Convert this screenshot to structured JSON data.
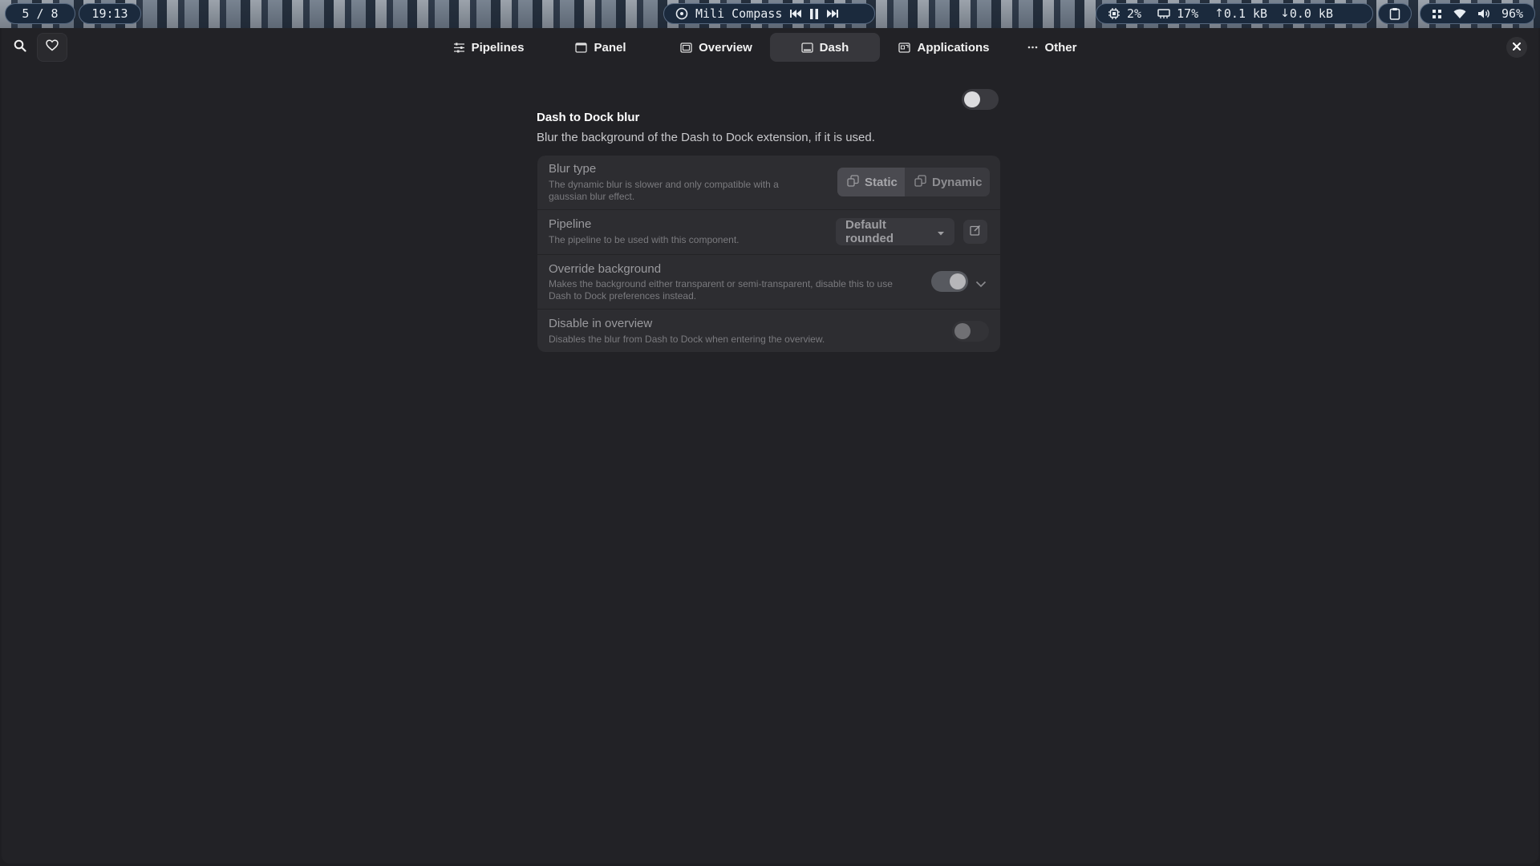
{
  "topbar": {
    "workspace": "5 / 8",
    "clock": "19:13",
    "media": {
      "title": "Mili Compass",
      "disc_icon": "disc-icon",
      "prev_icon": "previous-track-icon",
      "pause_icon": "pause-icon",
      "next_icon": "next-track-icon"
    },
    "stats": {
      "cpu": "2%",
      "memory": "17%",
      "upload": "0.1 kB",
      "download": "0.0 kB"
    },
    "clipboard_icon": "clipboard-icon",
    "tray": {
      "battery": "96%",
      "icons": [
        "apps-icon",
        "wifi-icon",
        "volume-icon"
      ]
    }
  },
  "headerbar": {
    "search_icon": "search-icon",
    "favorite_icon": "heart-icon",
    "close_icon": "close-icon",
    "tabs": [
      {
        "label": "Pipelines",
        "icon": "sliders-icon",
        "active": false
      },
      {
        "label": "Panel",
        "icon": "panel-icon",
        "active": false
      },
      {
        "label": "Overview",
        "icon": "overview-icon",
        "active": false
      },
      {
        "label": "Dash",
        "icon": "dash-icon",
        "active": true
      },
      {
        "label": "Applications",
        "icon": "applications-icon",
        "active": false
      },
      {
        "label": "Other",
        "icon": "more-icon",
        "active": false
      }
    ]
  },
  "group": {
    "title": "Dash to Dock blur",
    "description": "Blur the background of the Dash to Dock extension, if it is used.",
    "enabled": false
  },
  "rows": {
    "blur_type": {
      "title": "Blur type",
      "subtitle_line1": "The dynamic blur is slower and only compatible with a",
      "subtitle_line2": "gaussian blur effect.",
      "options": [
        "Static",
        "Dynamic"
      ],
      "selected": "Static"
    },
    "pipeline": {
      "title": "Pipeline",
      "subtitle": "The pipeline to be used with this component.",
      "selected": "Default rounded",
      "edit_icon": "edit-icon"
    },
    "override_background": {
      "title": "Override background",
      "subtitle_line1": "Makes the background either transparent or semi-transparent, disable this to use",
      "subtitle_line2": "Dash to Dock preferences instead.",
      "enabled": true
    },
    "disable_in_overview": {
      "title": "Disable in overview",
      "subtitle": "Disables the blur from Dash to Dock when entering the overview.",
      "enabled": false
    }
  },
  "colors": {
    "window_bg": "#222226",
    "card_bg": "#2d2d31",
    "active_tab_bg": "#37373c",
    "topbar_pill_bg": "#1b2a3d"
  }
}
